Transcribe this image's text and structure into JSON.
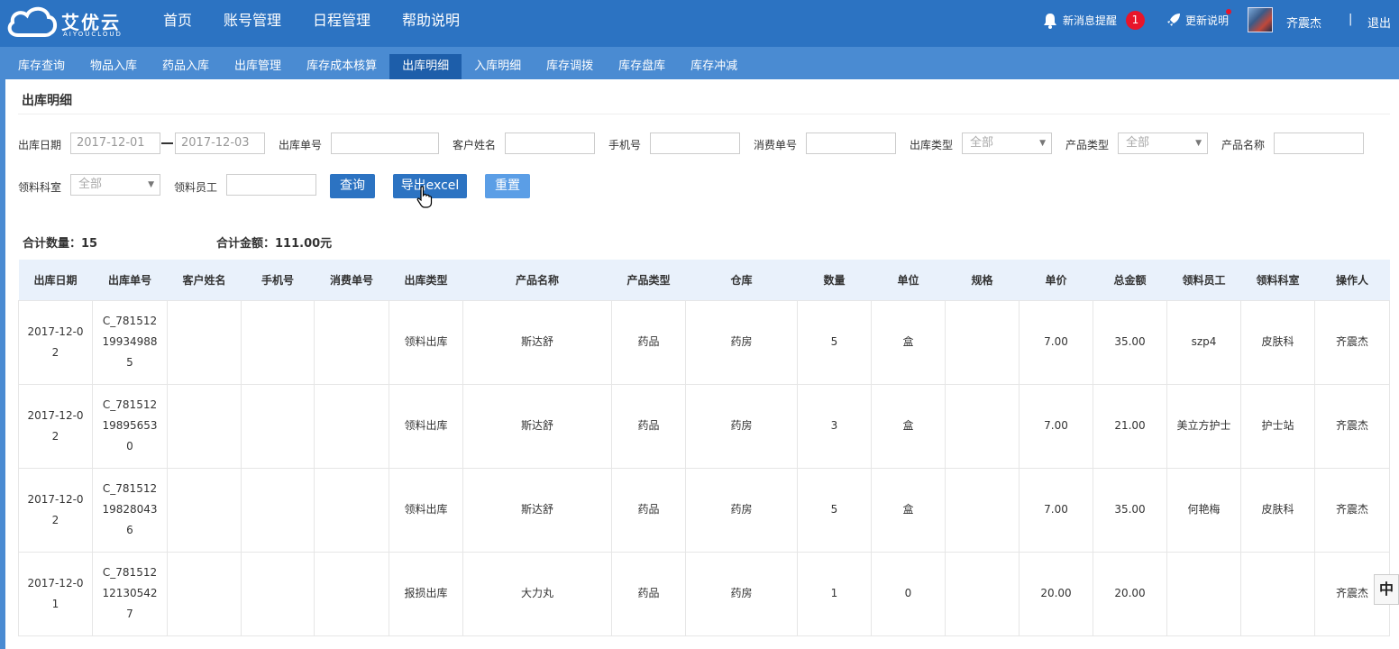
{
  "app": {
    "logo_text": "艾优云",
    "logo_sub": "AIYOUCLOUD"
  },
  "main_nav": [
    "首页",
    "账号管理",
    "日程管理",
    "帮助说明"
  ],
  "header_right": {
    "messages_label": "新消息提醒",
    "messages_count": "1",
    "updates_label": "更新说明",
    "user_name": "齐震杰",
    "separator": "|",
    "logout_label": "退出"
  },
  "sub_nav": {
    "items": [
      "库存查询",
      "物品入库",
      "药品入库",
      "出库管理",
      "库存成本核算",
      "出库明细",
      "入库明细",
      "库存调拨",
      "库存盘库",
      "库存冲减"
    ],
    "active": "出库明细"
  },
  "page_title": "出库明细",
  "filters": {
    "date_label": "出库日期",
    "date_from": "2017-12-01",
    "date_to": "2017-12-03",
    "order_no_label": "出库单号",
    "customer_label": "客户姓名",
    "phone_label": "手机号",
    "consume_no_label": "消费单号",
    "out_type_label": "出库类型",
    "out_type_value": "全部",
    "product_type_label": "产品类型",
    "product_type_value": "全部",
    "product_name_label": "产品名称",
    "dept_label": "领料科室",
    "dept_value": "全部",
    "staff_label": "领料员工"
  },
  "buttons": {
    "query": "查询",
    "export": "导出excel",
    "reset": "重置"
  },
  "summary": {
    "qty_label": "合计数量：",
    "qty_value": "15",
    "amount_label": "合计金额：",
    "amount_value": "111.00元"
  },
  "table": {
    "headers": [
      "出库日期",
      "出库单号",
      "客户姓名",
      "手机号",
      "消费单号",
      "出库类型",
      "产品名称",
      "产品类型",
      "仓库",
      "数量",
      "单位",
      "规格",
      "单价",
      "总金额",
      "领料员工",
      "领料科室",
      "操作人"
    ],
    "rows": [
      [
        "2017-12-02",
        "C_781512199349885",
        "",
        "",
        "",
        "领料出库",
        "斯达舒",
        "药品",
        "药房",
        "5",
        "盒",
        "",
        "7.00",
        "35.00",
        "szp4",
        "皮肤科",
        "齐震杰"
      ],
      [
        "2017-12-02",
        "C_781512198956530",
        "",
        "",
        "",
        "领料出库",
        "斯达舒",
        "药品",
        "药房",
        "3",
        "盒",
        "",
        "7.00",
        "21.00",
        "美立方护士",
        "护士站",
        "齐震杰"
      ],
      [
        "2017-12-02",
        "C_781512198280436",
        "",
        "",
        "",
        "领料出库",
        "斯达舒",
        "药品",
        "药房",
        "5",
        "盒",
        "",
        "7.00",
        "35.00",
        "何艳梅",
        "皮肤科",
        "齐震杰"
      ],
      [
        "2017-12-01",
        "C_781512121305427",
        "",
        "",
        "",
        "报损出库",
        "大力丸",
        "药品",
        "药房",
        "1",
        "0",
        "",
        "20.00",
        "20.00",
        "",
        "",
        "齐震杰"
      ]
    ]
  },
  "ime_indicator": "中"
}
